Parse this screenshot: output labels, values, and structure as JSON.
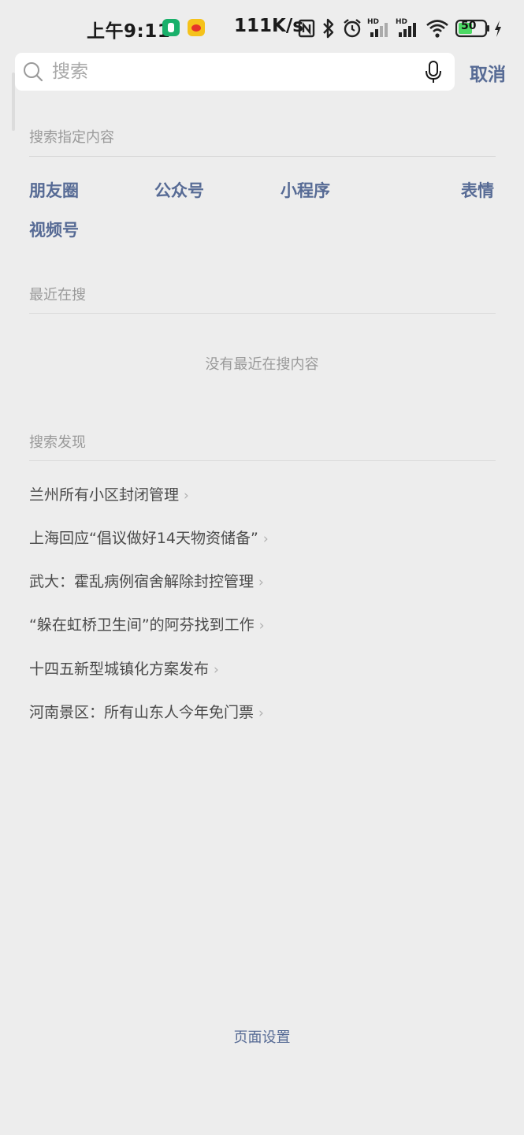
{
  "status_bar": {
    "time": "上午9:11",
    "network_speed": "111K/s",
    "battery": "50"
  },
  "search": {
    "placeholder": "搜索",
    "value": "",
    "cancel_label": "取消"
  },
  "search_specific": {
    "title": "搜索指定内容",
    "categories": [
      "朋友圈",
      "公众号",
      "小程序",
      "表情",
      "视频号"
    ]
  },
  "recent": {
    "title": "最近在搜",
    "empty_text": "没有最近在搜内容"
  },
  "discover": {
    "title": "搜索发现",
    "items": [
      "兰州所有小区封闭管理",
      "上海回应“倡议做好14天物资储备”",
      "武大：霍乱病例宿舍解除封控管理",
      "“躲在虹桥卫生间”的阿芬找到工作",
      "十四五新型城镇化方案发布",
      "河南景区：所有山东人今年免门票"
    ]
  },
  "footer": {
    "page_settings": "页面设置"
  },
  "colors": {
    "background": "#ededed",
    "link": "#576b95",
    "muted": "#9a9a9a",
    "battery_green": "#4cd964"
  }
}
